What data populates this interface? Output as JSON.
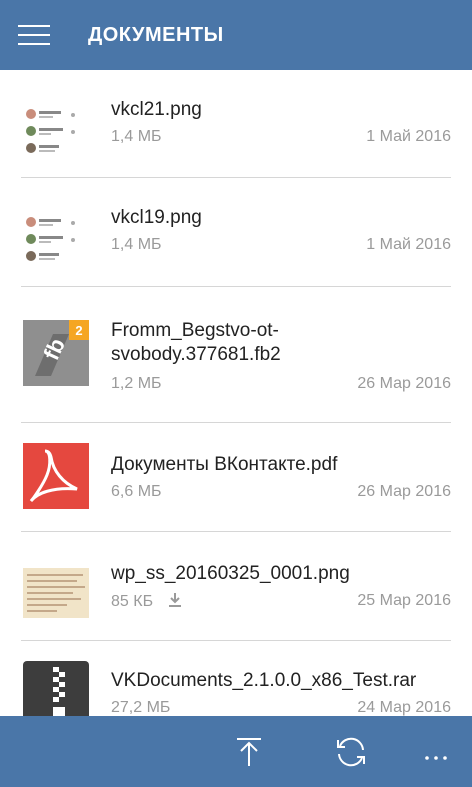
{
  "header": {
    "title": "ДОКУМЕНТЫ",
    "menu_icon": "hamburger-icon"
  },
  "documents": [
    {
      "name_line1": "vkcl21.png",
      "name_line2": "",
      "size": "1,4 МБ",
      "date": "1 Май 2016",
      "type": "image-chat"
    },
    {
      "name_line1": "vkcl19.png",
      "name_line2": "",
      "size": "1,4 МБ",
      "date": "1 Май 2016",
      "type": "image-chat"
    },
    {
      "name_line1": "Fromm_Begstvo-ot-",
      "name_line2": "svobody.377681.fb2",
      "size": "1,2 МБ",
      "date": "26 Мар 2016",
      "type": "fb2"
    },
    {
      "name_line1": "Документы ВКонтакте.pdf",
      "name_line2": "",
      "size": "6,6 МБ",
      "date": "26 Мар 2016",
      "type": "pdf"
    },
    {
      "name_line1": "wp_ss_20160325_0001.png",
      "name_line2": "",
      "size": "85 КБ",
      "date": "25 Мар 2016",
      "type": "image-text",
      "downloaded_icon": "download-icon"
    },
    {
      "name_line1": "VKDocuments_2.1.0.0_x86_Test.rar",
      "name_line2": "",
      "size": "27,2 МБ",
      "date": "24 Мар 2016",
      "type": "archive"
    }
  ],
  "bottom_bar": {
    "icons": [
      "upload-icon",
      "refresh-icon",
      "more-icon"
    ]
  },
  "colors": {
    "accent": "#4a76a8",
    "pdf": "#e5483f",
    "fb2_badge": "#f5a623",
    "archive": "#3d3d3d"
  }
}
